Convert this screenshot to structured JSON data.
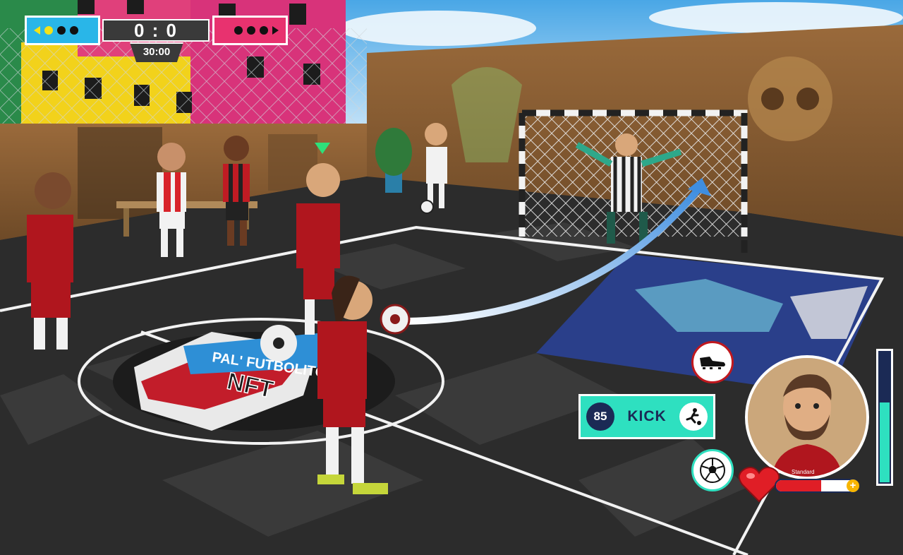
{
  "scoreboard": {
    "score": "0 : 0",
    "timer": "30:00",
    "home_color": "#29b6e8",
    "away_color": "#e8326f"
  },
  "pitch_logo": {
    "line1": "PAL' FUTBOLITO",
    "line2": "NFT"
  },
  "controls": {
    "kick_power": "85",
    "kick_label": "KICK",
    "kick_icon": "kicking-player-icon",
    "boot_icon": "boot-icon",
    "ball_icon": "soccer-ball-icon",
    "stamina_level": 0.6,
    "health_level": 0.55
  },
  "player_card": {
    "kit_label": "Standard"
  },
  "colors": {
    "accent": "#2ee0c0",
    "navy": "#1b2a55",
    "red_kit": "#b0161e"
  }
}
